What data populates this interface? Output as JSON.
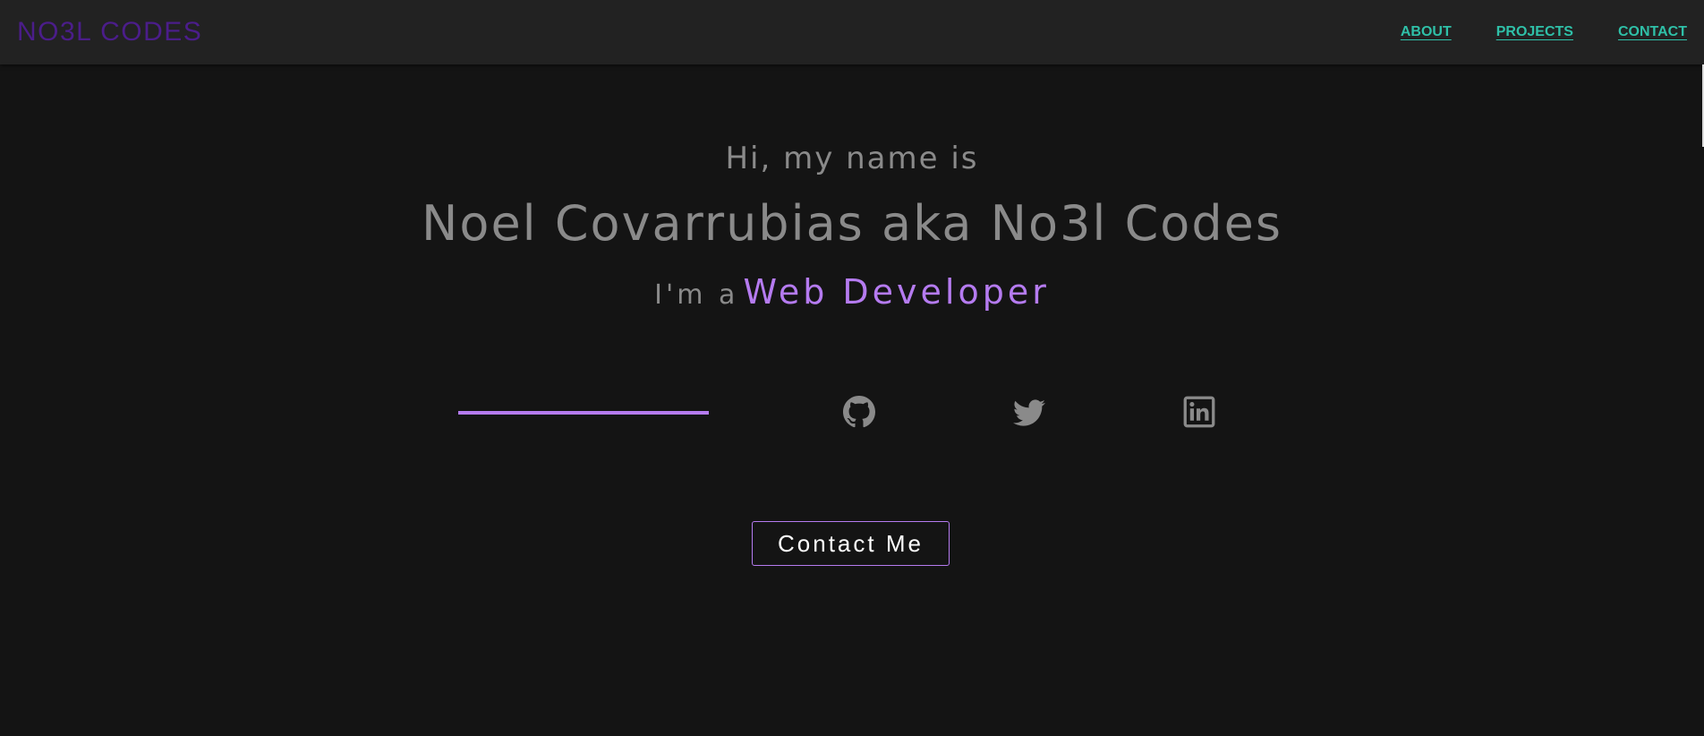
{
  "nav": {
    "brand": "NO3L CODES",
    "links": [
      {
        "label": "ABOUT"
      },
      {
        "label": "PROJECTS"
      },
      {
        "label": "CONTACT"
      }
    ]
  },
  "hero": {
    "greeting": "Hi, my name is",
    "name": "Noel Covarrubias aka No3l Codes",
    "role_prefix": "I'm a",
    "role_title": "Web Developer",
    "button_label": "Contact Me"
  },
  "social": [
    {
      "icon": "github-icon"
    },
    {
      "icon": "twitter-icon"
    },
    {
      "icon": "linkedin-icon"
    }
  ],
  "colors": {
    "background": "#141414",
    "navbar": "#222222",
    "brand": "#4b1d8a",
    "nav_link": "#2fc0a8",
    "accent": "#b57bf0",
    "muted_text": "#8a8a8a"
  }
}
